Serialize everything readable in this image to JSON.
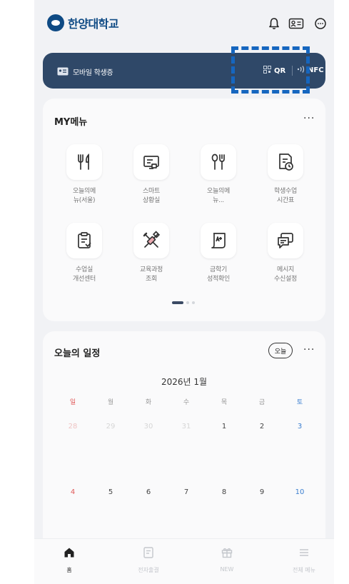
{
  "header": {
    "logo_text": "한양대학교",
    "icons": [
      "bell-icon",
      "id-card-icon",
      "chat-icon"
    ]
  },
  "student_card": {
    "label": "모바일 학생증",
    "qr_label": "QR",
    "nfc_label": "NFC",
    "colors": {
      "background": "#2f4868",
      "highlight": "#1666bf"
    }
  },
  "my_menu": {
    "title": "MY메뉴",
    "more": "···",
    "items": [
      {
        "label": "오늘의메\n뉴(서울)",
        "icon": "fork-knife-icon"
      },
      {
        "label": "스마트\n상황실",
        "icon": "monitor-icon"
      },
      {
        "label": "오늘의메\n뉴...",
        "icon": "spoon-fork-icon"
      },
      {
        "label": "학생수업\n시간표",
        "icon": "timetable-icon"
      },
      {
        "label": "수업실\n개선센터",
        "icon": "clipboard-icon"
      },
      {
        "label": "교육과정\n조회",
        "icon": "tools-icon"
      },
      {
        "label": "금학기\n성적확인",
        "icon": "grade-icon"
      },
      {
        "label": "메시지\n수신설정",
        "icon": "message-icon"
      }
    ],
    "pages": {
      "current": 1,
      "total": 3
    }
  },
  "schedule": {
    "title": "오늘의 일정",
    "today_button": "오늘",
    "more": "···",
    "month": "2026년 1월",
    "weekdays": [
      "일",
      "월",
      "화",
      "수",
      "목",
      "금",
      "토"
    ],
    "weeks": [
      [
        "28",
        "29",
        "30",
        "31",
        "1",
        "2",
        "3"
      ],
      [
        "4",
        "5",
        "6",
        "7",
        "8",
        "9",
        "10"
      ]
    ],
    "colors": {
      "sunday": "#e05a5a",
      "saturday": "#3b7fd0",
      "dim": "#d6d6d6"
    }
  },
  "bottom_nav": {
    "items": [
      {
        "label": "홈",
        "icon": "home-icon",
        "active": true
      },
      {
        "label": "전자출결",
        "icon": "attendance-icon",
        "active": false
      },
      {
        "label": "NEW",
        "icon": "gift-icon",
        "active": false
      },
      {
        "label": "전체 메뉴",
        "icon": "menu-icon",
        "active": false
      }
    ]
  }
}
